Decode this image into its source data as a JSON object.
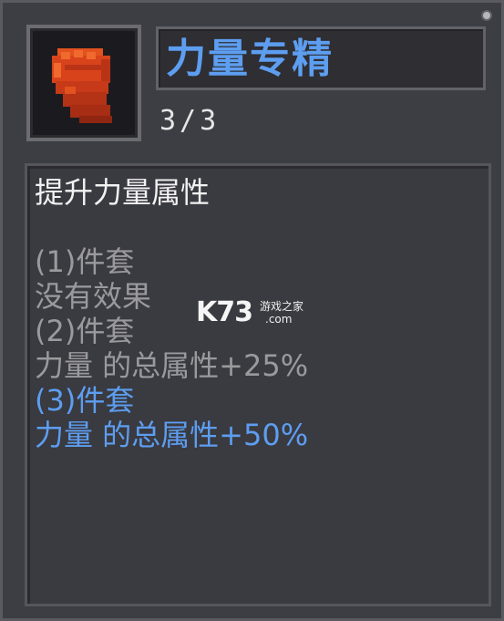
{
  "skill": {
    "name": "力量专精",
    "level": "3/3",
    "icon": "fist-icon",
    "description": "提升力量属性"
  },
  "set_bonuses": [
    {
      "label": "(1)件套",
      "effect": "没有效果",
      "active": false
    },
    {
      "label": "(2)件套",
      "effect": "力量 的总属性+25%",
      "active": false
    },
    {
      "label": "(3)件套",
      "effect": "力量 的总属性+50%",
      "active": true
    }
  ],
  "watermark": {
    "logo": "K73",
    "site_name": "游戏之家",
    "domain": ".com"
  },
  "colors": {
    "accent_blue": "#5d9ef0",
    "inactive_gray": "#9a9a9e",
    "panel_bg": "#3d3d44",
    "icon_red": "#d9431c"
  }
}
